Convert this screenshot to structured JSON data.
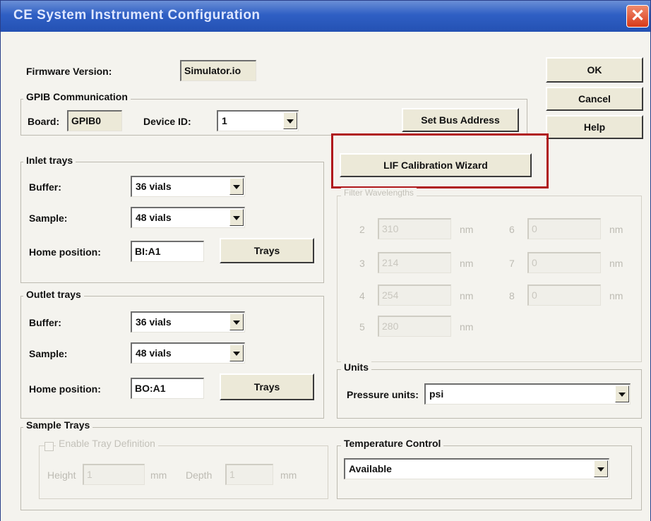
{
  "window": {
    "title": "CE System Instrument Configuration",
    "close_glyph": "✕"
  },
  "firmware": {
    "label": "Firmware Version:",
    "value": "Simulator.io"
  },
  "buttons": {
    "ok": "OK",
    "cancel": "Cancel",
    "help": "Help",
    "set_bus_address": "Set Bus Address",
    "lif_wizard": "LIF Calibration Wizard"
  },
  "gpib": {
    "title": "GPIB Communication",
    "board_label": "Board:",
    "board_value": "GPIB0",
    "device_label": "Device ID:",
    "device_value": "1"
  },
  "inlet": {
    "title": "Inlet trays",
    "buffer_label": "Buffer:",
    "buffer_value": "36 vials",
    "sample_label": "Sample:",
    "sample_value": "48 vials",
    "home_label": "Home position:",
    "home_value": "BI:A1",
    "trays_button": "Trays"
  },
  "outlet": {
    "title": "Outlet trays",
    "buffer_label": "Buffer:",
    "buffer_value": "36 vials",
    "sample_label": "Sample:",
    "sample_value": "48 vials",
    "home_label": "Home position:",
    "home_value": "BO:A1",
    "trays_button": "Trays"
  },
  "wavelengths": {
    "title": "Filter Wavelengths",
    "unit": "nm",
    "entries": [
      {
        "num": "2",
        "value": "310"
      },
      {
        "num": "3",
        "value": "214"
      },
      {
        "num": "4",
        "value": "254"
      },
      {
        "num": "5",
        "value": "280"
      },
      {
        "num": "6",
        "value": "0"
      },
      {
        "num": "7",
        "value": "0"
      },
      {
        "num": "8",
        "value": "0"
      }
    ]
  },
  "units": {
    "title": "Units",
    "pressure_label": "Pressure units:",
    "pressure_value": "psi"
  },
  "sample_trays": {
    "title": "Sample Trays",
    "enable_label": "Enable Tray Definition",
    "height_label": "Height",
    "height_value": "1",
    "depth_label": "Depth",
    "depth_value": "1",
    "unit": "mm"
  },
  "temperature": {
    "title": "Temperature Control",
    "value": "Available"
  }
}
